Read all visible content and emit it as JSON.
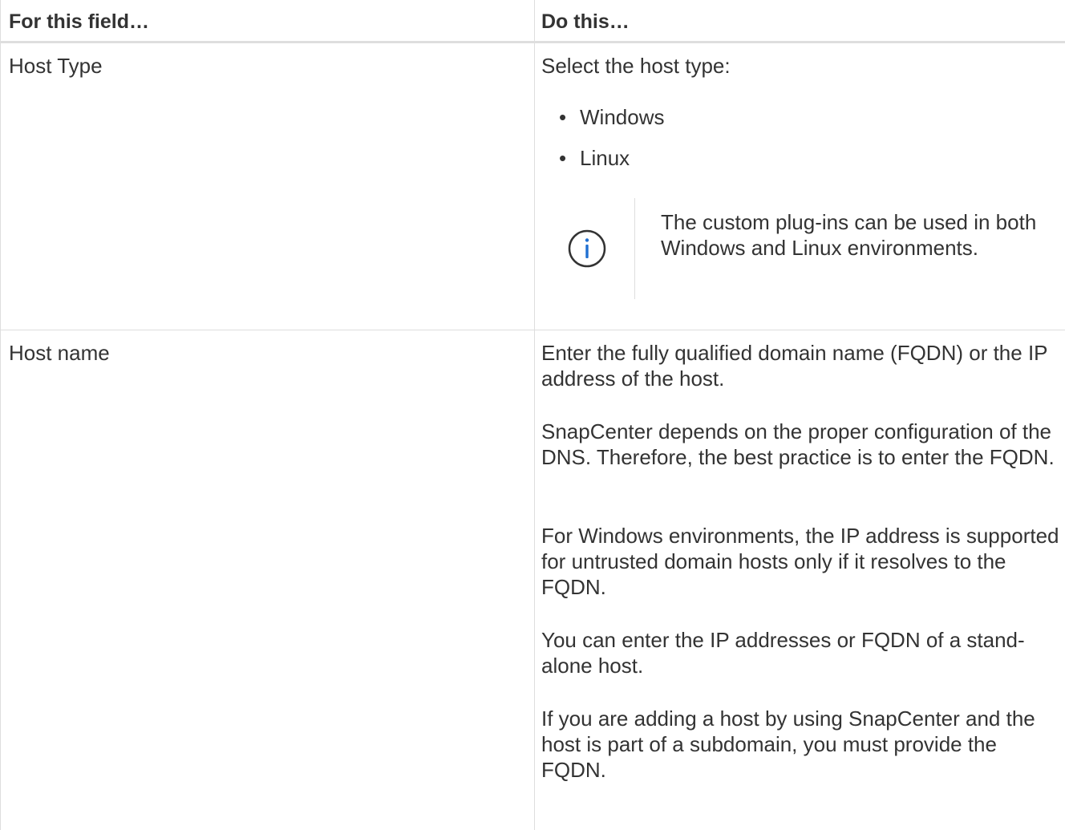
{
  "table": {
    "headers": {
      "field": "For this field…",
      "action": "Do this…"
    },
    "rows": [
      {
        "field": "Host Type",
        "intro": "Select the host type:",
        "options": [
          "Windows",
          "Linux"
        ],
        "note": {
          "icon": "info-icon",
          "text": "The custom plug-ins can be used in both Windows and Linux environments."
        }
      },
      {
        "field": "Host name",
        "paragraphs": [
          "Enter the fully qualified domain name (FQDN) or the IP address of the host.",
          "SnapCenter depends on the proper configuration of the DNS. Therefore, the best practice is to enter the FQDN.",
          "For Windows environments, the IP address is supported for untrusted domain hosts only if it resolves to the FQDN.",
          "You can enter the IP addresses or FQDN of a stand-alone host.",
          "If you are adding a host by using SnapCenter and the host is part of a subdomain, you must provide the FQDN."
        ]
      }
    ],
    "bullet": "•"
  },
  "colors": {
    "text": "#333333",
    "border": "#dedede",
    "info_icon": "#1f6fd1"
  }
}
